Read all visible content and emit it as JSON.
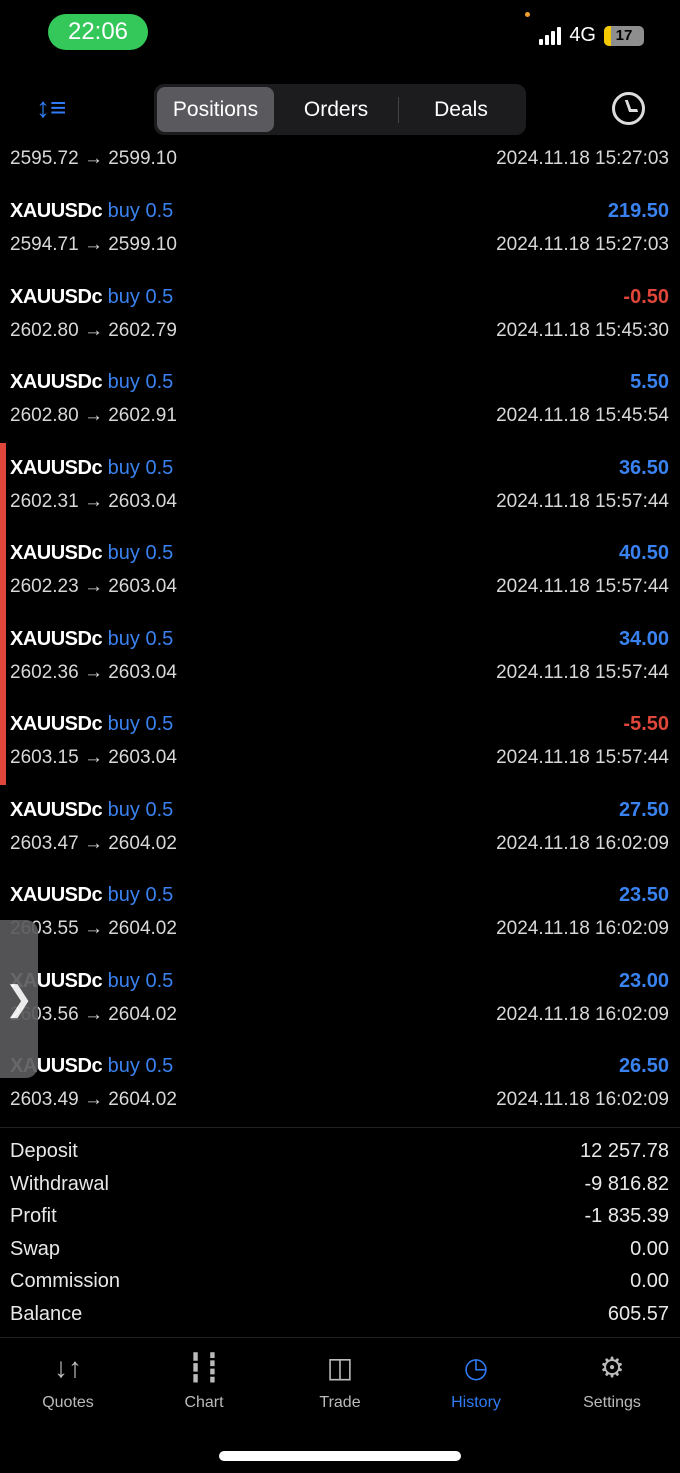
{
  "status": {
    "time": "22:06",
    "network": "4G",
    "battery": "17"
  },
  "tabs": [
    {
      "label": "Positions",
      "active": true
    },
    {
      "label": "Orders"
    },
    {
      "label": "Deals"
    }
  ],
  "first_row": {
    "prices": "2595.72 → 2599.10",
    "time": "2024.11.18 15:27:03"
  },
  "deals": [
    {
      "symbol": "XAUUSDc",
      "side": "buy 0.5",
      "profit": "219.50",
      "prices": "2594.71 → 2599.10",
      "time": "2024.11.18 15:27:03",
      "color": "#3a82f0"
    },
    {
      "symbol": "XAUUSDc",
      "side": "buy 0.5",
      "profit": "-0.50",
      "prices": "2602.80 → 2602.79",
      "time": "2024.11.18 15:45:30",
      "color": "#e0463a"
    },
    {
      "symbol": "XAUUSDc",
      "side": "buy 0.5",
      "profit": "5.50",
      "prices": "2602.80 → 2602.91",
      "time": "2024.11.18 15:45:54",
      "color": "#3a82f0"
    },
    {
      "symbol": "XAUUSDc",
      "side": "buy 0.5",
      "profit": "36.50",
      "prices": "2602.31 → 2603.04",
      "time": "2024.11.18 15:57:44",
      "color": "#3a82f0"
    },
    {
      "symbol": "XAUUSDc",
      "side": "buy 0.5",
      "profit": "40.50",
      "prices": "2602.23 → 2603.04",
      "time": "2024.11.18 15:57:44",
      "color": "#3a82f0"
    },
    {
      "symbol": "XAUUSDc",
      "side": "buy 0.5",
      "profit": "34.00",
      "prices": "2602.36 → 2603.04",
      "time": "2024.11.18 15:57:44",
      "color": "#3a82f0"
    },
    {
      "symbol": "XAUUSDc",
      "side": "buy 0.5",
      "profit": "-5.50",
      "prices": "2603.15 → 2603.04",
      "time": "2024.11.18 15:57:44",
      "color": "#e0463a"
    },
    {
      "symbol": "XAUUSDc",
      "side": "buy 0.5",
      "profit": "27.50",
      "prices": "2603.47 → 2604.02",
      "time": "2024.11.18 16:02:09",
      "color": "#3a82f0"
    },
    {
      "symbol": "XAUUSDc",
      "side": "buy 0.5",
      "profit": "23.50",
      "prices": "2603.55 → 2604.02",
      "time": "2024.11.18 16:02:09",
      "color": "#3a82f0"
    },
    {
      "symbol": "XAUUSDc",
      "side": "buy 0.5",
      "profit": "23.00",
      "prices": "2603.56 → 2604.02",
      "time": "2024.11.18 16:02:09",
      "color": "#3a82f0"
    },
    {
      "symbol": "XAUUSDc",
      "side": "buy 0.5",
      "profit": "26.50",
      "prices": "2603.49 → 2604.02",
      "time": "2024.11.18 16:02:09",
      "color": "#3a82f0"
    }
  ],
  "summary": [
    {
      "label": "Deposit",
      "value": "12 257.78"
    },
    {
      "label": "Withdrawal",
      "value": "-9 816.82"
    },
    {
      "label": "Profit",
      "value": "-1 835.39"
    },
    {
      "label": "Swap",
      "value": "0.00"
    },
    {
      "label": "Commission",
      "value": "0.00"
    },
    {
      "label": "Balance",
      "value": "605.57"
    }
  ],
  "bottom_tabs": [
    {
      "label": "Quotes",
      "icon": "quotes-icon",
      "glyph": "↓↑"
    },
    {
      "label": "Chart",
      "icon": "candlestick-icon",
      "glyph": "┇┋"
    },
    {
      "label": "Trade",
      "icon": "trade-chart-icon",
      "glyph": "◫"
    },
    {
      "label": "History",
      "icon": "history-icon",
      "glyph": "◷",
      "active": true
    },
    {
      "label": "Settings",
      "icon": "gear-icon",
      "glyph": "⚙"
    }
  ],
  "side_handle": "❯"
}
